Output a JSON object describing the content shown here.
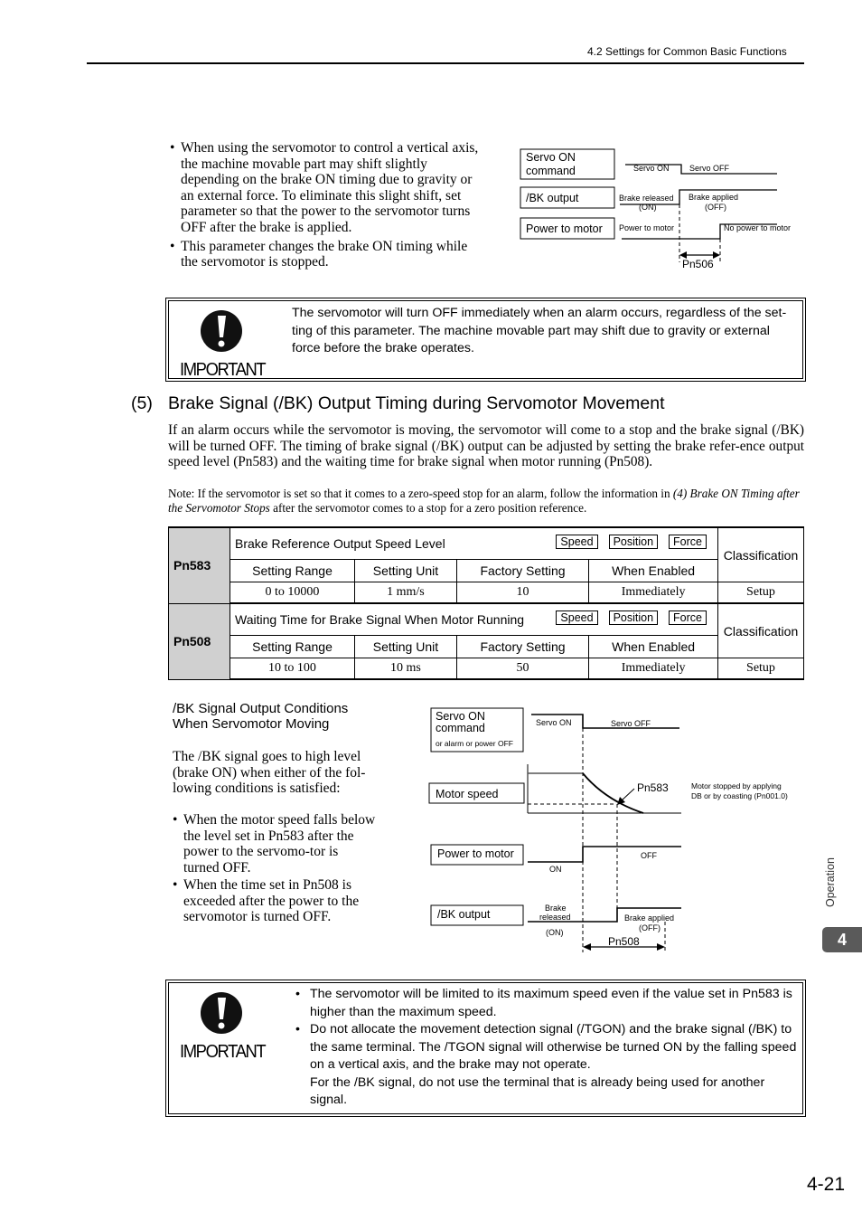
{
  "header": {
    "running_title": "4.2  Settings for Common Basic Functions"
  },
  "top_section": {
    "bullets": [
      "When using the servomotor to control a vertical axis, the machine movable part may shift slightly depending on the brake ON timing due to gravity or an external force. To eliminate this slight shift, set parameter so that the power to the servomotor turns OFF after the brake is applied.",
      "This parameter changes the brake ON timing while the servomotor is stopped."
    ],
    "timing_chart": {
      "signals": [
        {
          "label_line1": "Servo ON",
          "label_line2": "command",
          "state_before": "Servo ON",
          "state_after": "Servo OFF"
        },
        {
          "label_line1": "/BK  output",
          "state_before_line1": "Brake released",
          "state_before_line2": "(ON)",
          "state_after_line1": "Brake applied",
          "state_after_line2": "(OFF)"
        },
        {
          "label_line1": "Power to motor",
          "state_before": "Power to motor",
          "state_after": "No power to motor"
        }
      ],
      "interval_label": "Pn506"
    }
  },
  "important1": {
    "icon": "exclamation-circle-icon",
    "word": "IMPORTANT",
    "text": "The servomotor will turn OFF immediately when an alarm occurs, regardless of the set-ting of this parameter. The machine movable part may shift due to gravity or external force before the brake operates."
  },
  "section5": {
    "number": "(5)",
    "title": "Brake Signal (/BK) Output Timing during Servomotor Movement",
    "intro": "If an alarm occurs while the servomotor is moving, the servomotor will come to a stop and the brake signal (/BK) will be turned OFF. The timing of brake signal (/BK) output can be adjusted by setting the brake refer-ence output speed level (Pn583) and the waiting time for brake signal when motor running (Pn508).",
    "note_prefix": "Note: If the servomotor is set so that it comes to a zero-speed stop for an alarm, follow the information in ",
    "note_italic": "(4) Brake ON Timing after the Servomotor Stops",
    "note_suffix": " after the servomotor comes to a stop for a zero position reference."
  },
  "param_table": {
    "col_headers": [
      "Setting Range",
      "Setting Unit",
      "Factory Setting",
      "When Enabled"
    ],
    "classification_label": "Classification",
    "tags": [
      "Speed",
      "Position",
      "Force"
    ],
    "params": [
      {
        "id": "Pn583",
        "name": "Brake Reference Output Speed Level",
        "range": "0 to 10000",
        "unit": "1 mm/s",
        "factory": "10",
        "enabled": "Immediately",
        "classification": "Setup"
      },
      {
        "id": "Pn508",
        "name": "Waiting Time for Brake Signal When Motor Running",
        "range": "10 to 100",
        "unit": "10 ms",
        "factory": "50",
        "enabled": "Immediately",
        "classification": "Setup"
      }
    ]
  },
  "bk_conditions": {
    "heading_line1": "/BK Signal Output Conditions",
    "heading_line2": "When Servomotor Moving",
    "para": "The /BK signal goes to high level (brake ON) when either of the fol-lowing conditions is satisfied:",
    "bullets": [
      "When the motor speed falls below the level set in Pn583 after the power to the servomo-tor is turned OFF.",
      "When the time set in Pn508 is exceeded after the power to the servomotor is turned OFF."
    ]
  },
  "timing_chart2": {
    "servo_label_line1": "Servo ON",
    "servo_label_line2": "command",
    "servo_label_line3": "or alarm or power OFF",
    "servo_before": "Servo ON",
    "servo_after": "Servo OFF",
    "speed_label": "Motor speed",
    "speed_marker": "Pn583",
    "speed_note_line1": "Motor stopped by applying",
    "speed_note_line2": "DB or by coasting  (Pn001.0)",
    "power_label": "Power to motor",
    "power_before": "ON",
    "power_after": "OFF",
    "bk_label": "/BK output",
    "bk_before_line1": "Brake",
    "bk_before_line2": "released",
    "bk_before_line3": "(ON)",
    "bk_after_line1": "Brake applied",
    "bk_after_line2": "(OFF)",
    "interval_label": "Pn508"
  },
  "important2": {
    "icon": "exclamation-circle-icon",
    "word": "IMPORTANT",
    "bullets": [
      "The servomotor will be limited to its maximum speed even if the value set in Pn583 is higher than the maximum speed.",
      "Do not allocate the movement detection signal (/TGON) and the brake signal (/BK) to the same terminal. The /TGON signal will otherwise be turned ON by the falling speed on a vertical axis, and the brake may not operate."
    ],
    "extra": "For the /BK signal, do not use the terminal that is already being used for another signal."
  },
  "side_tab": {
    "label": "Operation",
    "chapter": "4"
  },
  "footer": {
    "page_number": "4-21"
  }
}
